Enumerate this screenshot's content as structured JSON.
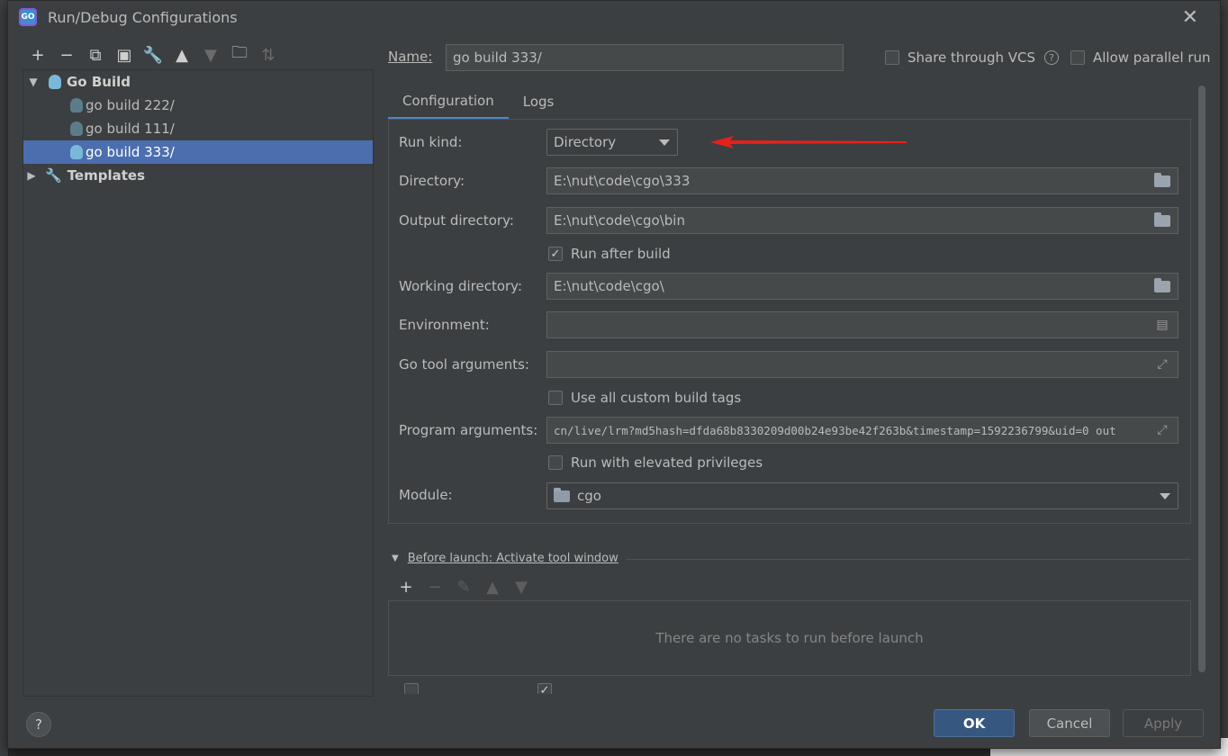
{
  "window": {
    "title": "Run/Debug Configurations",
    "app_icon": "GO"
  },
  "toolbar": [
    "add-icon",
    "remove-icon",
    "copy-icon",
    "save-icon",
    "wrench-icon",
    "move-up-icon",
    "move-down-icon",
    "folder-add-icon",
    "sort-icon"
  ],
  "tree": {
    "group": "Go Build",
    "items": [
      "go build 222/",
      "go build 111/",
      "go build 333/"
    ],
    "selected": "go build 333/",
    "templates": "Templates"
  },
  "header": {
    "name_label": "Name:",
    "name_value": "go build 333/",
    "share_vcs": "Share through VCS",
    "help": "?",
    "allow_parallel": "Allow parallel run"
  },
  "tabs": [
    "Configuration",
    "Logs"
  ],
  "form": {
    "run_kind_label": "Run kind:",
    "run_kind_value": "Directory",
    "directory_label": "Directory:",
    "directory_value": "E:\\nut\\code\\cgo\\333",
    "output_label": "Output directory:",
    "output_value": "E:\\nut\\code\\cgo\\bin",
    "run_after_build": "Run after build",
    "working_label": "Working directory:",
    "working_value": "E:\\nut\\code\\cgo\\",
    "env_label": "Environment:",
    "env_value": "",
    "gotool_label": "Go tool arguments:",
    "gotool_value": "",
    "custom_tags": "Use all custom build tags",
    "program_label": "Program arguments:",
    "program_value": "cn/live/lrm?md5hash=dfda68b8330209d00b24e93be42f263b&timestamp=1592236799&uid=0 out",
    "elevated": "Run with elevated privileges",
    "module_label": "Module:",
    "module_value": "cgo"
  },
  "before_launch": {
    "title": "Before launch: Activate tool window",
    "empty": "There are no tasks to run before launch"
  },
  "buttons": {
    "help": "?",
    "ok": "OK",
    "cancel": "Cancel",
    "apply": "Apply"
  },
  "colors": {
    "accent": "#4a88c7",
    "selection": "#4b6eaf",
    "primary_button": "#365880",
    "annotation_arrow": "#e8201a"
  }
}
